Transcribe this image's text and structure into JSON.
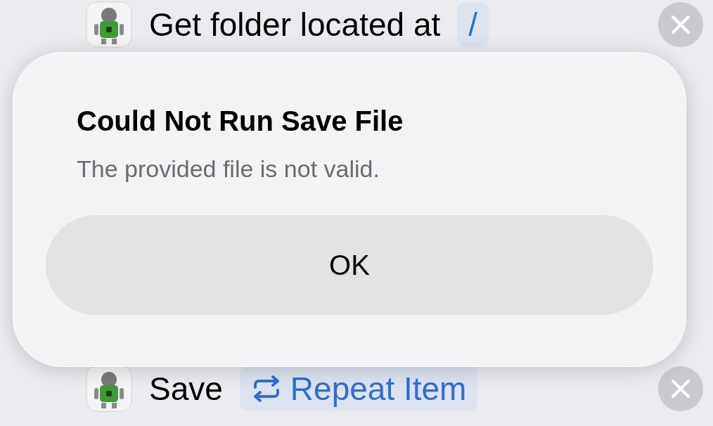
{
  "actions": [
    {
      "text": "Get folder located at",
      "token": {
        "kind": "plain",
        "text": "/"
      }
    },
    {
      "text": "Save",
      "token": {
        "kind": "repeat",
        "text": "Repeat Item"
      }
    }
  ],
  "alert": {
    "title": "Could Not Run Save File",
    "message": "The provided file is not valid.",
    "buttons": [
      "OK"
    ]
  }
}
